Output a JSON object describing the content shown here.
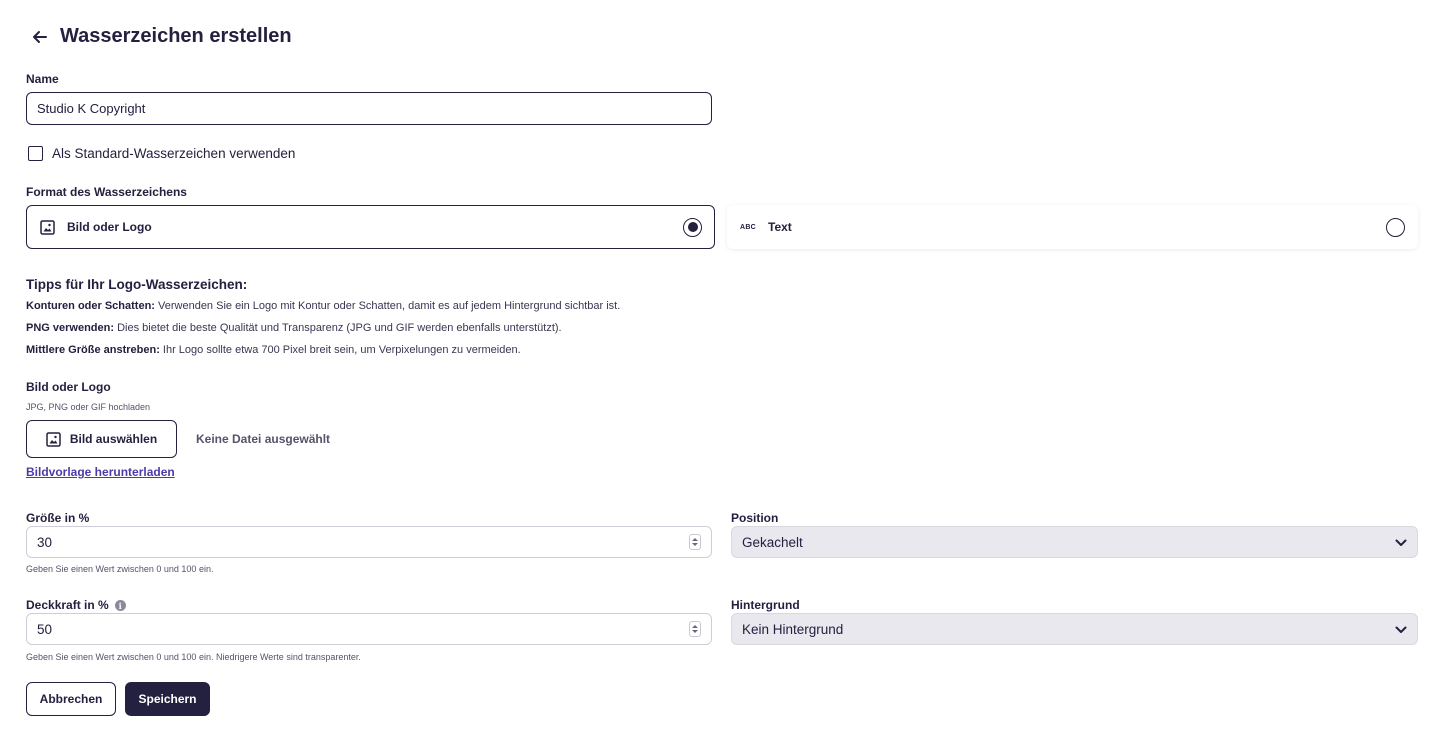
{
  "header": {
    "title": "Wasserzeichen erstellen",
    "back_icon": "arrow-left-icon"
  },
  "name_field": {
    "label": "Name",
    "value": "Studio K Copyright"
  },
  "default_checkbox": {
    "label": "Als Standard-Wasserzeichen verwenden",
    "checked": false
  },
  "format": {
    "label": "Format des Wasserzeichens",
    "options": [
      {
        "label": "Bild oder Logo",
        "icon": "image-icon",
        "selected": true
      },
      {
        "label": "Text",
        "icon": "abc-icon",
        "icon_text": "ABC",
        "selected": false
      }
    ]
  },
  "tips": {
    "title": "Tipps für Ihr Logo-Wasserzeichen:",
    "items": [
      {
        "bold": "Konturen oder Schatten:",
        "text": " Verwenden Sie ein Logo mit Kontur oder Schatten, damit es auf jedem Hintergrund sichtbar ist."
      },
      {
        "bold": "PNG verwenden:",
        "text": " Dies bietet die beste Qualität und Transparenz (JPG und GIF werden ebenfalls unterstützt)."
      },
      {
        "bold": "Mittlere Größe anstreben:",
        "text": " Ihr Logo sollte etwa 700 Pixel breit sein, um Verpixelungen zu vermeiden."
      }
    ]
  },
  "upload": {
    "label": "Bild oder Logo",
    "hint": "JPG, PNG oder GIF hochladen",
    "button_label": "Bild auswählen",
    "file_status": "Keine Datei ausgewählt",
    "template_link": "Bildvorlage herunterladen"
  },
  "size_field": {
    "label": "Größe in %",
    "value": "30",
    "hint": "Geben Sie einen Wert zwischen 0 und 100 ein."
  },
  "position_field": {
    "label": "Position",
    "value": "Gekachelt"
  },
  "opacity_field": {
    "label": "Deckkraft in %",
    "value": "50",
    "hint": "Geben Sie einen Wert zwischen 0 und 100 ein. Niedrigere Werte sind transparenter.",
    "info_glyph": "i"
  },
  "background_field": {
    "label": "Hintergrund",
    "value": "Kein Hintergrund"
  },
  "actions": {
    "cancel_label": "Abbrechen",
    "save_label": "Speichern"
  },
  "colors": {
    "primary": "#24203f",
    "link": "#4b3ba8",
    "select_bg": "#e9e8ee"
  }
}
